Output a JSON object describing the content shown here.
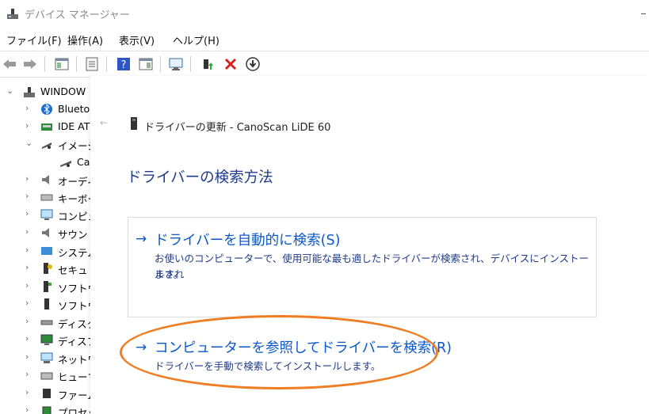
{
  "window": {
    "title": "デバイス マネージャー"
  },
  "menu": {
    "file": "ファイル(F)",
    "action": "操作(A)",
    "view": "表示(V)",
    "help": "ヘルプ(H)"
  },
  "tree": {
    "root": "WINDOW",
    "items": [
      "Blueto",
      "IDE AT",
      "イメージ",
      "Ca",
      "オーディ",
      "キーボー",
      "コンピュ",
      "サウン",
      "システム",
      "セキュ",
      "ソフトウ",
      "ソフトウ",
      "ディスク",
      "ディスフ",
      "ネットワ",
      "ヒューマ",
      "ファーム",
      "プロセッ"
    ]
  },
  "dialog": {
    "title": "ドライバーの更新 - CanoScan LiDE 60",
    "heading": "ドライバーの検索方法",
    "option1": {
      "arrow": "→",
      "title": "ドライバーを自動的に検索(S)",
      "desc_line1": "お使いのコンピューターで、使用可能な最も適したドライバーが検索され、デバイスにインストールされ",
      "desc_line2": "ます。"
    },
    "option2": {
      "arrow": "→",
      "title": "コンピューターを参照してドライバーを検索(R)",
      "desc": "ドライバーを手動で検索してインストールします。"
    }
  },
  "colors": {
    "link_blue": "#0a58ca",
    "heading_blue": "#1e3a8a",
    "highlight": "#ee7d24"
  }
}
